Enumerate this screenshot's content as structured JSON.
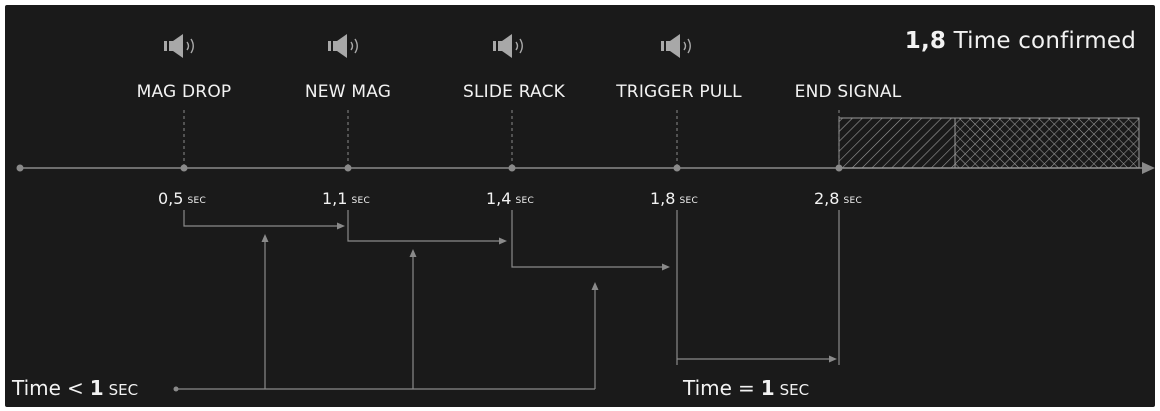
{
  "title": {
    "value": "1,8",
    "text": "Time confirmed"
  },
  "events": [
    {
      "label": "MAG DROP",
      "time": "0,5",
      "unit": "SEC",
      "sound": true
    },
    {
      "label": "NEW MAG",
      "time": "1,1",
      "unit": "SEC",
      "sound": true
    },
    {
      "label": "SLIDE RACK",
      "time": "1,4",
      "unit": "SEC",
      "sound": true
    },
    {
      "label": "TRIGGER PULL",
      "time": "1,8",
      "unit": "SEC",
      "sound": true
    },
    {
      "label": "END SIGNAL",
      "time": "2,8",
      "unit": "SEC",
      "sound": false
    }
  ],
  "notes": {
    "left": {
      "prefix": "Time",
      "op": "<",
      "value": "1",
      "unit": "SEC"
    },
    "right": {
      "prefix": "Time",
      "op": "=",
      "value": "1",
      "unit": "SEC"
    }
  },
  "icons": {
    "sound": "speaker-icon"
  },
  "colors": {
    "background": "#1a1a1a",
    "line": "#8a8a8a",
    "text": "#f2f2f2"
  }
}
